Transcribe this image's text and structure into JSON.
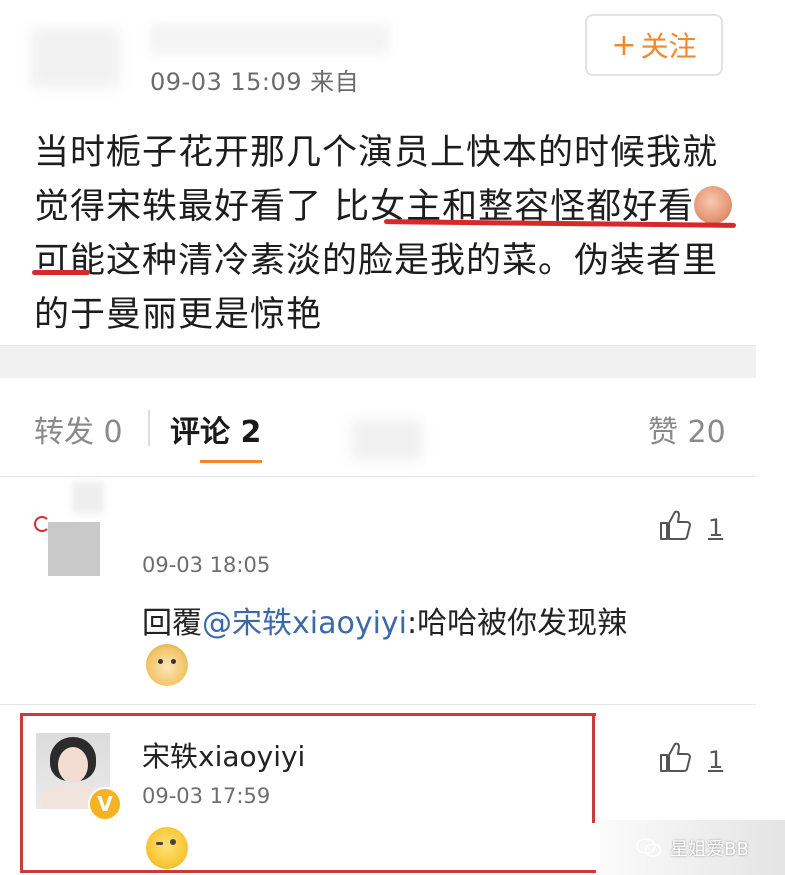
{
  "post": {
    "meta": "09-03 15:09  来自",
    "follow_label": "关注",
    "follow_plus": "+",
    "text_part1": "当时栀子花开那几个演员上快本的时候我就觉得宋轶最好看了 比女主和整容怪都好看",
    "text_part2": "可能这种清冷素淡的脸是我的菜。伪装者里的于曼丽更是惊艳"
  },
  "tabs": {
    "repost": "转发 0",
    "comment": "评论 2",
    "like": "赞 20"
  },
  "comments": [
    {
      "time": "09-03 18:05",
      "reply_prefix": "回覆",
      "mention": "@宋轶xiaoyiyi",
      "reply_text": ":哈哈被你发现辣",
      "like_count": "1",
      "emoji_icon": "doge-emoji-icon"
    },
    {
      "name": "宋轶xiaoyiyi",
      "time": "09-03 17:59",
      "like_count": "1",
      "verified_mark": "V",
      "emoji_icon": "wink-emoji-icon"
    }
  ],
  "watermark": {
    "text": "星姐爱BB"
  },
  "colors": {
    "accent": "#f0882e",
    "mention": "#3c69a8",
    "highlight_border": "#c93c3c",
    "underline_mark": "#d8282c",
    "verified": "#f5b324"
  }
}
